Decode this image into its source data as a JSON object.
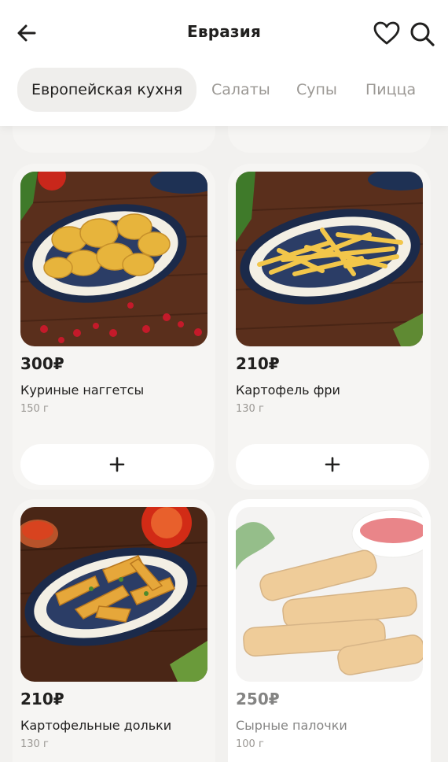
{
  "header": {
    "title": "Евразия"
  },
  "tabs": [
    "Европейская кухня",
    "Салаты",
    "Супы",
    "Пицца"
  ],
  "products": [
    {
      "price": "300₽",
      "name": "Куриные наггетсы",
      "weight": "150 г",
      "image": "chicken-nuggets-plate"
    },
    {
      "price": "210₽",
      "name": "Картофель фри",
      "weight": "130 г",
      "image": "french-fries-plate"
    },
    {
      "price": "210₽",
      "name": "Картофельные дольки",
      "weight": "130 г",
      "image": "potato-wedges-plate"
    },
    {
      "price": "250₽",
      "name": "Сырные палочки",
      "weight": "100 г",
      "image": "cheese-sticks-plate",
      "available": false
    }
  ],
  "icons": {
    "back": "arrow-left-icon",
    "favorite": "heart-icon",
    "search": "search-icon",
    "add": "plus-icon"
  },
  "colors": {
    "background": "#f2f1ef",
    "card": "#f6f5f3",
    "text": "#21201f",
    "muted": "#9b9894",
    "active_tab_bg": "#efeeec"
  }
}
